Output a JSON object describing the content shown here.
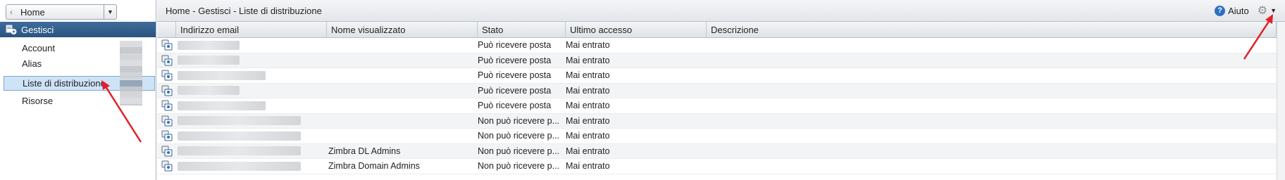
{
  "left_nav": {
    "home_label": "Home",
    "section_title": "Gestisci",
    "items": [
      {
        "label": "Account"
      },
      {
        "label": "Alias"
      },
      {
        "label": "Liste di distribuzione"
      },
      {
        "label": "Risorse"
      }
    ]
  },
  "topbar": {
    "breadcrumb": "Home - Gestisci - Liste di distribuzione",
    "help_label": "Aiuto"
  },
  "table": {
    "columns": [
      "Indirizzo email",
      "Nome visualizzato",
      "Stato",
      "Ultimo accesso",
      "Descrizione"
    ],
    "rows": [
      {
        "display_name": "",
        "status": "Può ricevere posta",
        "last_access": "Mai entrato"
      },
      {
        "display_name": "",
        "status": "Può ricevere posta",
        "last_access": "Mai entrato"
      },
      {
        "display_name": "",
        "status": "Può ricevere posta",
        "last_access": "Mai entrato"
      },
      {
        "display_name": "",
        "status": "Può ricevere posta",
        "last_access": "Mai entrato"
      },
      {
        "display_name": "",
        "status": "Può ricevere posta",
        "last_access": "Mai entrato"
      },
      {
        "display_name": "",
        "status": "Non può ricevere p...",
        "last_access": "Mai entrato"
      },
      {
        "display_name": "",
        "status": "Non può ricevere p...",
        "last_access": "Mai entrato"
      },
      {
        "display_name": "Zimbra DL Admins",
        "status": "Non può ricevere p...",
        "last_access": "Mai entrato"
      },
      {
        "display_name": "Zimbra Domain Admins",
        "status": "Non può ricevere p...",
        "last_access": "Mai entrato"
      }
    ]
  },
  "colors": {
    "nav_header": "#2b5480",
    "selected_row": "#cfe3f7",
    "annotation_arrow": "#e0202a"
  }
}
